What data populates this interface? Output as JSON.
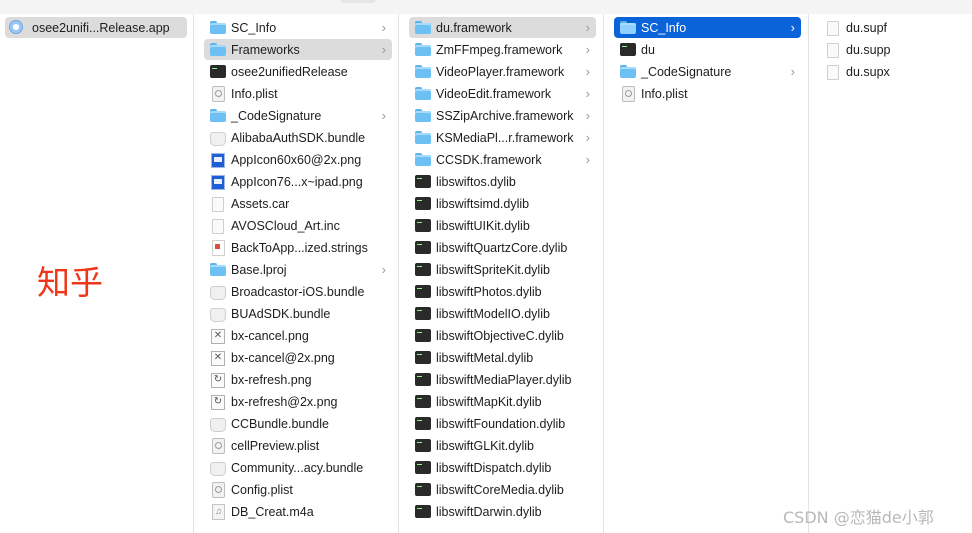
{
  "col1": {
    "items": [
      {
        "label": "osee2unifi...Release.app",
        "icon": "app-icon",
        "selected": "gray"
      }
    ]
  },
  "col2": {
    "items": [
      {
        "label": "SC_Info",
        "icon": "folder-icon",
        "chevron": true
      },
      {
        "label": "Frameworks",
        "icon": "folder-icon",
        "chevron": true,
        "selected": "gray"
      },
      {
        "label": "osee2unifiedRelease",
        "icon": "executable-icon"
      },
      {
        "label": "Info.plist",
        "icon": "plist-icon"
      },
      {
        "label": "_CodeSignature",
        "icon": "folder-icon",
        "chevron": true
      },
      {
        "label": "AlibabaAuthSDK.bundle",
        "icon": "bundle-icon"
      },
      {
        "label": "AppIcon60x60@2x.png",
        "icon": "image-icon"
      },
      {
        "label": "AppIcon76...x~ipad.png",
        "icon": "image-icon"
      },
      {
        "label": "Assets.car",
        "icon": "document-icon"
      },
      {
        "label": "AVOSCloud_Art.inc",
        "icon": "document-icon"
      },
      {
        "label": "BackToApp...ized.strings",
        "icon": "strings-icon"
      },
      {
        "label": "Base.lproj",
        "icon": "folder-icon",
        "chevron": true
      },
      {
        "label": "Broadcastor-iOS.bundle",
        "icon": "bundle-icon"
      },
      {
        "label": "BUAdSDK.bundle",
        "icon": "bundle-icon"
      },
      {
        "label": "bx-cancel.png",
        "icon": "cancel-image-icon"
      },
      {
        "label": "bx-cancel@2x.png",
        "icon": "cancel-image-icon"
      },
      {
        "label": "bx-refresh.png",
        "icon": "refresh-image-icon"
      },
      {
        "label": "bx-refresh@2x.png",
        "icon": "refresh-image-icon"
      },
      {
        "label": "CCBundle.bundle",
        "icon": "bundle-icon"
      },
      {
        "label": "cellPreview.plist",
        "icon": "plist-icon"
      },
      {
        "label": "Community...acy.bundle",
        "icon": "bundle-icon"
      },
      {
        "label": "Config.plist",
        "icon": "plist-icon"
      },
      {
        "label": "DB_Creat.m4a",
        "icon": "audio-icon"
      }
    ]
  },
  "col3": {
    "items": [
      {
        "label": "du.framework",
        "icon": "folder-icon",
        "chevron": true,
        "selected": "gray"
      },
      {
        "label": "ZmFFmpeg.framework",
        "icon": "folder-icon",
        "chevron": true
      },
      {
        "label": "VideoPlayer.framework",
        "icon": "folder-icon",
        "chevron": true
      },
      {
        "label": "VideoEdit.framework",
        "icon": "folder-icon",
        "chevron": true
      },
      {
        "label": "SSZipArchive.framework",
        "icon": "folder-icon",
        "chevron": true
      },
      {
        "label": "KSMediaPl...r.framework",
        "icon": "folder-icon",
        "chevron": true
      },
      {
        "label": "CCSDK.framework",
        "icon": "folder-icon",
        "chevron": true
      },
      {
        "label": "libswiftos.dylib",
        "icon": "executable-icon"
      },
      {
        "label": "libswiftsimd.dylib",
        "icon": "executable-icon"
      },
      {
        "label": "libswiftUIKit.dylib",
        "icon": "executable-icon"
      },
      {
        "label": "libswiftQuartzCore.dylib",
        "icon": "executable-icon"
      },
      {
        "label": "libswiftSpriteKit.dylib",
        "icon": "executable-icon"
      },
      {
        "label": "libswiftPhotos.dylib",
        "icon": "executable-icon"
      },
      {
        "label": "libswiftModelIO.dylib",
        "icon": "executable-icon"
      },
      {
        "label": "libswiftObjectiveC.dylib",
        "icon": "executable-icon"
      },
      {
        "label": "libswiftMetal.dylib",
        "icon": "executable-icon"
      },
      {
        "label": "libswiftMediaPlayer.dylib",
        "icon": "executable-icon"
      },
      {
        "label": "libswiftMapKit.dylib",
        "icon": "executable-icon"
      },
      {
        "label": "libswiftFoundation.dylib",
        "icon": "executable-icon"
      },
      {
        "label": "libswiftGLKit.dylib",
        "icon": "executable-icon"
      },
      {
        "label": "libswiftDispatch.dylib",
        "icon": "executable-icon"
      },
      {
        "label": "libswiftCoreMedia.dylib",
        "icon": "executable-icon"
      },
      {
        "label": "libswiftDarwin.dylib",
        "icon": "executable-icon"
      }
    ]
  },
  "col4": {
    "items": [
      {
        "label": "SC_Info",
        "icon": "folder-icon",
        "chevron": true,
        "selected": "blue"
      },
      {
        "label": "du",
        "icon": "executable-icon"
      },
      {
        "label": "_CodeSignature",
        "icon": "folder-icon",
        "chevron": true
      },
      {
        "label": "Info.plist",
        "icon": "plist-icon"
      }
    ]
  },
  "col5": {
    "items": [
      {
        "label": "du.supf",
        "icon": "document-icon"
      },
      {
        "label": "du.supp",
        "icon": "document-icon"
      },
      {
        "label": "du.supx",
        "icon": "document-icon"
      }
    ]
  },
  "overlay": {
    "zhihu_text": "知乎",
    "watermark_text": "CSDN @恋猫de小郭"
  },
  "colors": {
    "selection_blue": "#0a63d8",
    "selection_gray": "#dcdcdc",
    "folder": "#6cc0f3",
    "zhihu_red": "#f0351a"
  }
}
